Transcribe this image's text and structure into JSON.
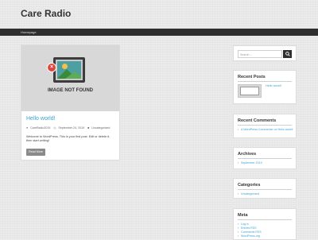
{
  "site": {
    "title": "Care Radio"
  },
  "nav": {
    "items": [
      {
        "label": "Homepage"
      }
    ]
  },
  "post": {
    "image_text": "IMAGE NOT FOUND",
    "title": "Hello world!",
    "author": "CareRadio2019",
    "date": "September 24, 2019",
    "category": "Uncategorized",
    "excerpt": "Welcome to WordPress. This is your first post. Edit or delete it, then start writing!",
    "read_more": "Read More"
  },
  "sidebar": {
    "search": {
      "placeholder": "Search ..."
    },
    "recent_posts": {
      "title": "Recent Posts",
      "items": [
        {
          "label": "Hello world!"
        }
      ]
    },
    "recent_comments": {
      "title": "Recent Comments",
      "items": [
        {
          "label": "A WordPress Commenter on Hello world!"
        }
      ]
    },
    "archives": {
      "title": "Archives",
      "items": [
        {
          "label": "September 2019"
        }
      ]
    },
    "categories": {
      "title": "Categories",
      "items": [
        {
          "label": "Uncategorized"
        }
      ]
    },
    "meta": {
      "title": "Meta",
      "items": [
        {
          "label": "Log in"
        },
        {
          "label": "Entries RSS"
        },
        {
          "label": "Comments RSS"
        },
        {
          "label": "WordPress.org"
        }
      ]
    }
  },
  "colors": {
    "accent": "#3aa3d6",
    "navbar": "#2f2f2f",
    "button": "#8a8a8a"
  }
}
